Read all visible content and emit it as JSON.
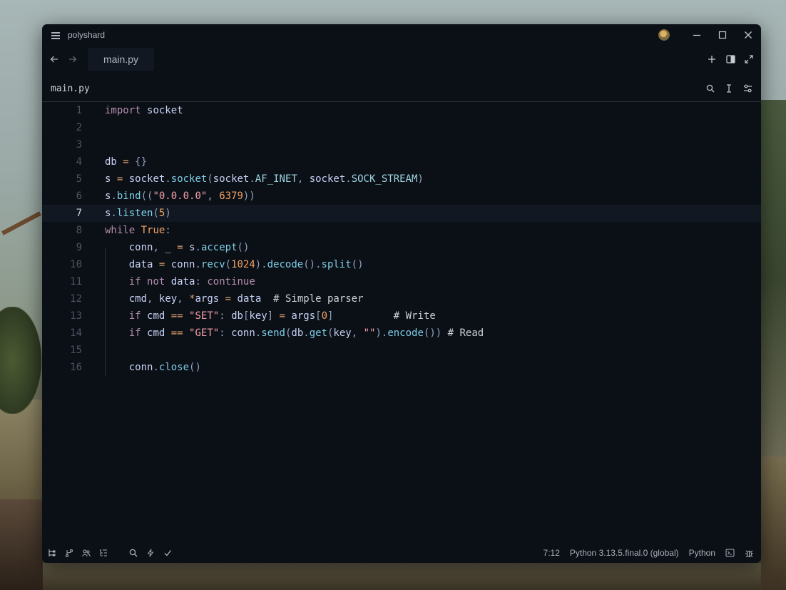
{
  "window": {
    "title": "polyshard"
  },
  "tabs": [
    {
      "label": "main.py"
    }
  ],
  "path": "main.py",
  "editor": {
    "lines": [
      {
        "num": "1",
        "tokens": [
          [
            "k",
            "import"
          ],
          [
            "c",
            " "
          ],
          [
            "v",
            "socket"
          ]
        ]
      },
      {
        "num": "2",
        "tokens": []
      },
      {
        "num": "3",
        "tokens": []
      },
      {
        "num": "4",
        "tokens": [
          [
            "v",
            "db"
          ],
          [
            "c",
            " "
          ],
          [
            "o",
            "="
          ],
          [
            "c",
            " "
          ],
          [
            "p",
            "{}"
          ]
        ]
      },
      {
        "num": "5",
        "tokens": [
          [
            "v",
            "s"
          ],
          [
            "c",
            " "
          ],
          [
            "o",
            "="
          ],
          [
            "c",
            " "
          ],
          [
            "v",
            "socket"
          ],
          [
            "p",
            "."
          ],
          [
            "f",
            "socket"
          ],
          [
            "p",
            "("
          ],
          [
            "v",
            "socket"
          ],
          [
            "p",
            "."
          ],
          [
            "a",
            "AF_INET"
          ],
          [
            "p",
            ","
          ],
          [
            "c",
            " "
          ],
          [
            "v",
            "socket"
          ],
          [
            "p",
            "."
          ],
          [
            "a",
            "SOCK_STREAM"
          ],
          [
            "p",
            ")"
          ]
        ]
      },
      {
        "num": "6",
        "tokens": [
          [
            "v",
            "s"
          ],
          [
            "p",
            "."
          ],
          [
            "f",
            "bind"
          ],
          [
            "p",
            "(("
          ],
          [
            "s",
            "\"0.0.0.0\""
          ],
          [
            "p",
            ","
          ],
          [
            "c",
            " "
          ],
          [
            "n",
            "6379"
          ],
          [
            "p",
            "))"
          ]
        ]
      },
      {
        "num": "7",
        "tokens": [
          [
            "v",
            "s"
          ],
          [
            "p",
            "."
          ],
          [
            "f",
            "listen"
          ],
          [
            "p",
            "("
          ],
          [
            "n",
            "5"
          ],
          [
            "p",
            ")"
          ]
        ]
      },
      {
        "num": "8",
        "tokens": [
          [
            "k",
            "while"
          ],
          [
            "c",
            " "
          ],
          [
            "n",
            "True"
          ],
          [
            "p",
            ":"
          ]
        ]
      },
      {
        "num": "9",
        "tokens": [
          [
            "c",
            "    "
          ],
          [
            "v",
            "conn"
          ],
          [
            "p",
            ","
          ],
          [
            "c",
            " "
          ],
          [
            "v",
            "_"
          ],
          [
            "c",
            " "
          ],
          [
            "o",
            "="
          ],
          [
            "c",
            " "
          ],
          [
            "v",
            "s"
          ],
          [
            "p",
            "."
          ],
          [
            "f",
            "accept"
          ],
          [
            "p",
            "()"
          ]
        ]
      },
      {
        "num": "10",
        "tokens": [
          [
            "c",
            "    "
          ],
          [
            "v",
            "data"
          ],
          [
            "c",
            " "
          ],
          [
            "o",
            "="
          ],
          [
            "c",
            " "
          ],
          [
            "v",
            "conn"
          ],
          [
            "p",
            "."
          ],
          [
            "f",
            "recv"
          ],
          [
            "p",
            "("
          ],
          [
            "n",
            "1024"
          ],
          [
            "p",
            ")."
          ],
          [
            "f",
            "decode"
          ],
          [
            "p",
            "()."
          ],
          [
            "f",
            "split"
          ],
          [
            "p",
            "()"
          ]
        ]
      },
      {
        "num": "11",
        "tokens": [
          [
            "c",
            "    "
          ],
          [
            "k",
            "if"
          ],
          [
            "c",
            " "
          ],
          [
            "k",
            "not"
          ],
          [
            "c",
            " "
          ],
          [
            "v",
            "data"
          ],
          [
            "p",
            ":"
          ],
          [
            "c",
            " "
          ],
          [
            "k",
            "continue"
          ]
        ]
      },
      {
        "num": "12",
        "tokens": [
          [
            "c",
            "    "
          ],
          [
            "v",
            "cmd"
          ],
          [
            "p",
            ","
          ],
          [
            "c",
            " "
          ],
          [
            "v",
            "key"
          ],
          [
            "p",
            ","
          ],
          [
            "c",
            " "
          ],
          [
            "o",
            "*"
          ],
          [
            "v",
            "args"
          ],
          [
            "c",
            " "
          ],
          [
            "o",
            "="
          ],
          [
            "c",
            " "
          ],
          [
            "v",
            "data"
          ],
          [
            "c",
            "  # Simple parser"
          ]
        ]
      },
      {
        "num": "13",
        "tokens": [
          [
            "c",
            "    "
          ],
          [
            "k",
            "if"
          ],
          [
            "c",
            " "
          ],
          [
            "v",
            "cmd"
          ],
          [
            "c",
            " "
          ],
          [
            "o",
            "=="
          ],
          [
            "c",
            " "
          ],
          [
            "s",
            "\"SET\""
          ],
          [
            "p",
            ":"
          ],
          [
            "c",
            " "
          ],
          [
            "v",
            "db"
          ],
          [
            "p",
            "["
          ],
          [
            "v",
            "key"
          ],
          [
            "p",
            "]"
          ],
          [
            "c",
            " "
          ],
          [
            "o",
            "="
          ],
          [
            "c",
            " "
          ],
          [
            "v",
            "args"
          ],
          [
            "p",
            "["
          ],
          [
            "n",
            "0"
          ],
          [
            "p",
            "]"
          ],
          [
            "c",
            "          # Write"
          ]
        ]
      },
      {
        "num": "14",
        "tokens": [
          [
            "c",
            "    "
          ],
          [
            "k",
            "if"
          ],
          [
            "c",
            " "
          ],
          [
            "v",
            "cmd"
          ],
          [
            "c",
            " "
          ],
          [
            "o",
            "=="
          ],
          [
            "c",
            " "
          ],
          [
            "s",
            "\"GET\""
          ],
          [
            "p",
            ":"
          ],
          [
            "c",
            " "
          ],
          [
            "v",
            "conn"
          ],
          [
            "p",
            "."
          ],
          [
            "f",
            "send"
          ],
          [
            "p",
            "("
          ],
          [
            "v",
            "db"
          ],
          [
            "p",
            "."
          ],
          [
            "f",
            "get"
          ],
          [
            "p",
            "("
          ],
          [
            "v",
            "key"
          ],
          [
            "p",
            ","
          ],
          [
            "c",
            " "
          ],
          [
            "s",
            "\"\""
          ],
          [
            "p",
            ")."
          ],
          [
            "f",
            "encode"
          ],
          [
            "p",
            "())"
          ],
          [
            "c",
            " # Read"
          ]
        ]
      },
      {
        "num": "15",
        "tokens": []
      },
      {
        "num": "16",
        "tokens": [
          [
            "c",
            "    "
          ],
          [
            "v",
            "conn"
          ],
          [
            "p",
            "."
          ],
          [
            "f",
            "close"
          ],
          [
            "p",
            "()"
          ]
        ]
      }
    ],
    "current_line": "7"
  },
  "status": {
    "cursor": "7:12",
    "interpreter": "Python 3.13.5.final.0 (global)",
    "language": "Python"
  }
}
